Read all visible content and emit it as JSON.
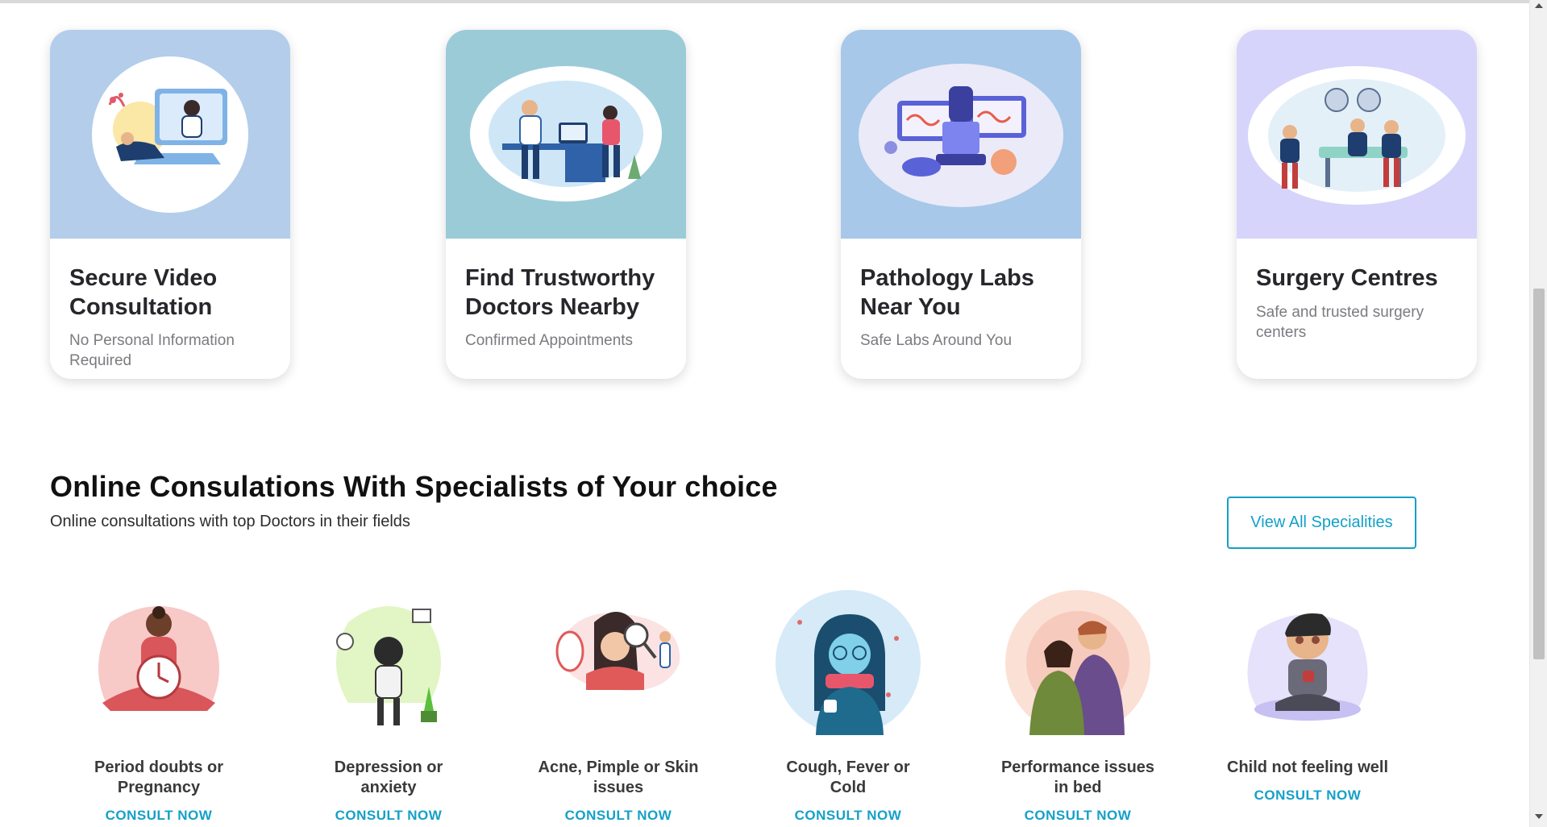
{
  "service_cards": [
    {
      "title": "Secure Video Consultation",
      "subtitle": "No Personal Information Required",
      "hero_color": "#b3cdeb",
      "icon": "video-consultation-illustration"
    },
    {
      "title": "Find Trustworthy Doctors Nearby",
      "subtitle": "Confirmed Appointments",
      "hero_color": "#9ccbd8",
      "icon": "doctor-appointment-illustration"
    },
    {
      "title": "Pathology Labs Near You",
      "subtitle": "Safe Labs Around You",
      "hero_color": "#a7c8e8",
      "icon": "lab-microscope-illustration"
    },
    {
      "title": "Surgery Centres",
      "subtitle": "Safe and trusted surgery centers",
      "hero_color": "#d6d4fb",
      "icon": "surgery-room-illustration"
    }
  ],
  "specialities_section": {
    "title": "Online Consulations With Specialists of Your choice",
    "subtitle": "Online consultations with top Doctors in their fields",
    "view_all_label": "View All Specialities",
    "accent_color": "#14a0c8"
  },
  "specialities": [
    {
      "label": "Period doubts or Pregnancy",
      "cta": "CONSULT NOW",
      "icon": "pregnancy-illustration"
    },
    {
      "label": "Depression or anxiety",
      "cta": "CONSULT NOW",
      "icon": "depression-illustration"
    },
    {
      "label": "Acne, Pimple or Skin issues",
      "cta": "CONSULT NOW",
      "icon": "skin-care-illustration"
    },
    {
      "label": "Cough, Fever or Cold",
      "cta": "CONSULT NOW",
      "icon": "cold-fever-illustration"
    },
    {
      "label": "Performance issues in bed",
      "cta": "CONSULT NOW",
      "icon": "couple-illustration"
    },
    {
      "label": "Child not feeling well",
      "cta": "CONSULT NOW",
      "icon": "sick-child-illustration"
    }
  ]
}
